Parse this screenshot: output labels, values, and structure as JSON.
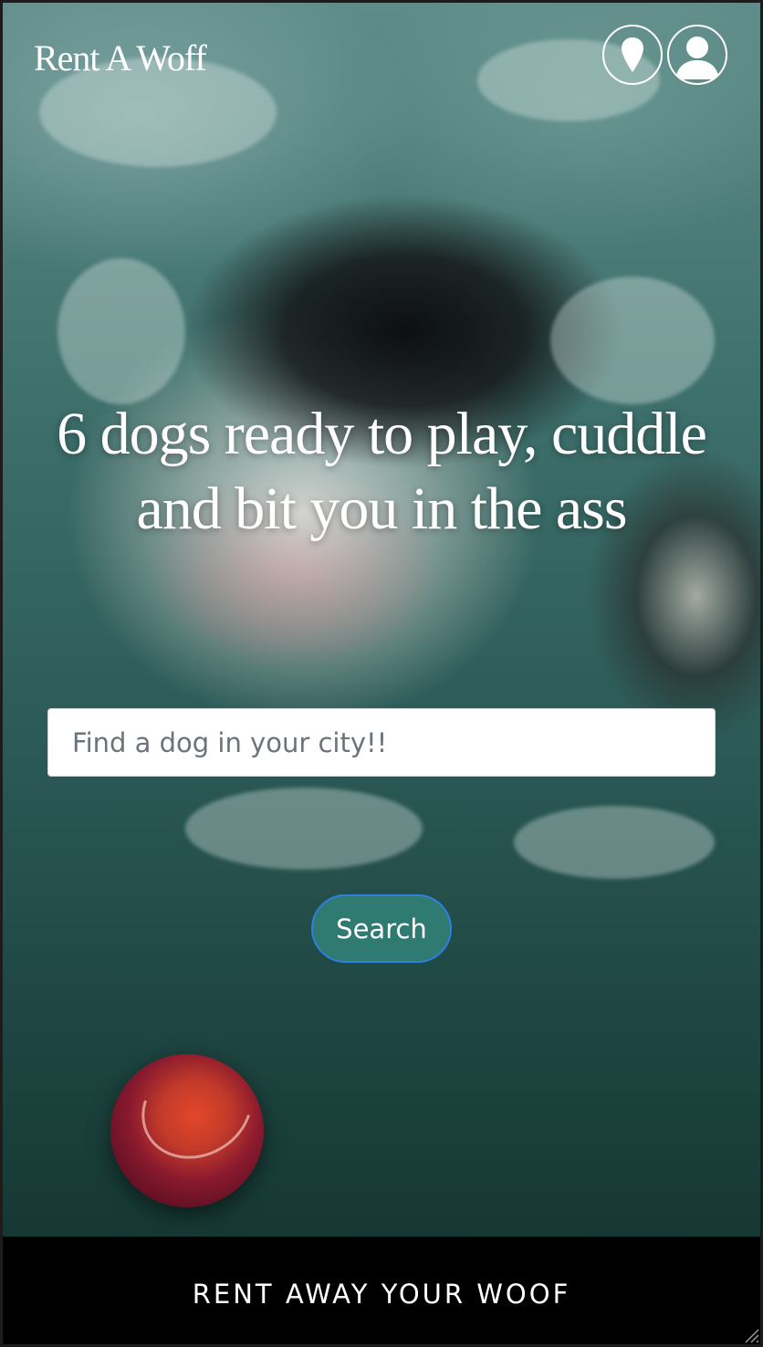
{
  "header": {
    "brand": "Rent A Woff",
    "location_icon": "location-pin-icon",
    "profile_icon": "user-profile-icon"
  },
  "hero": {
    "headline": "6 dogs ready to play, cuddle and bit you in the ass",
    "search": {
      "placeholder": "Find a dog in your city!!",
      "value": ""
    },
    "search_button_label": "Search"
  },
  "footer": {
    "text": "RENT AWAY YOUR WOOF"
  },
  "colors": {
    "search_button_bg": "#2f7b72",
    "search_button_border": "#2f7fe0",
    "footer_bg": "#000000",
    "text_light": "#ffffff"
  }
}
